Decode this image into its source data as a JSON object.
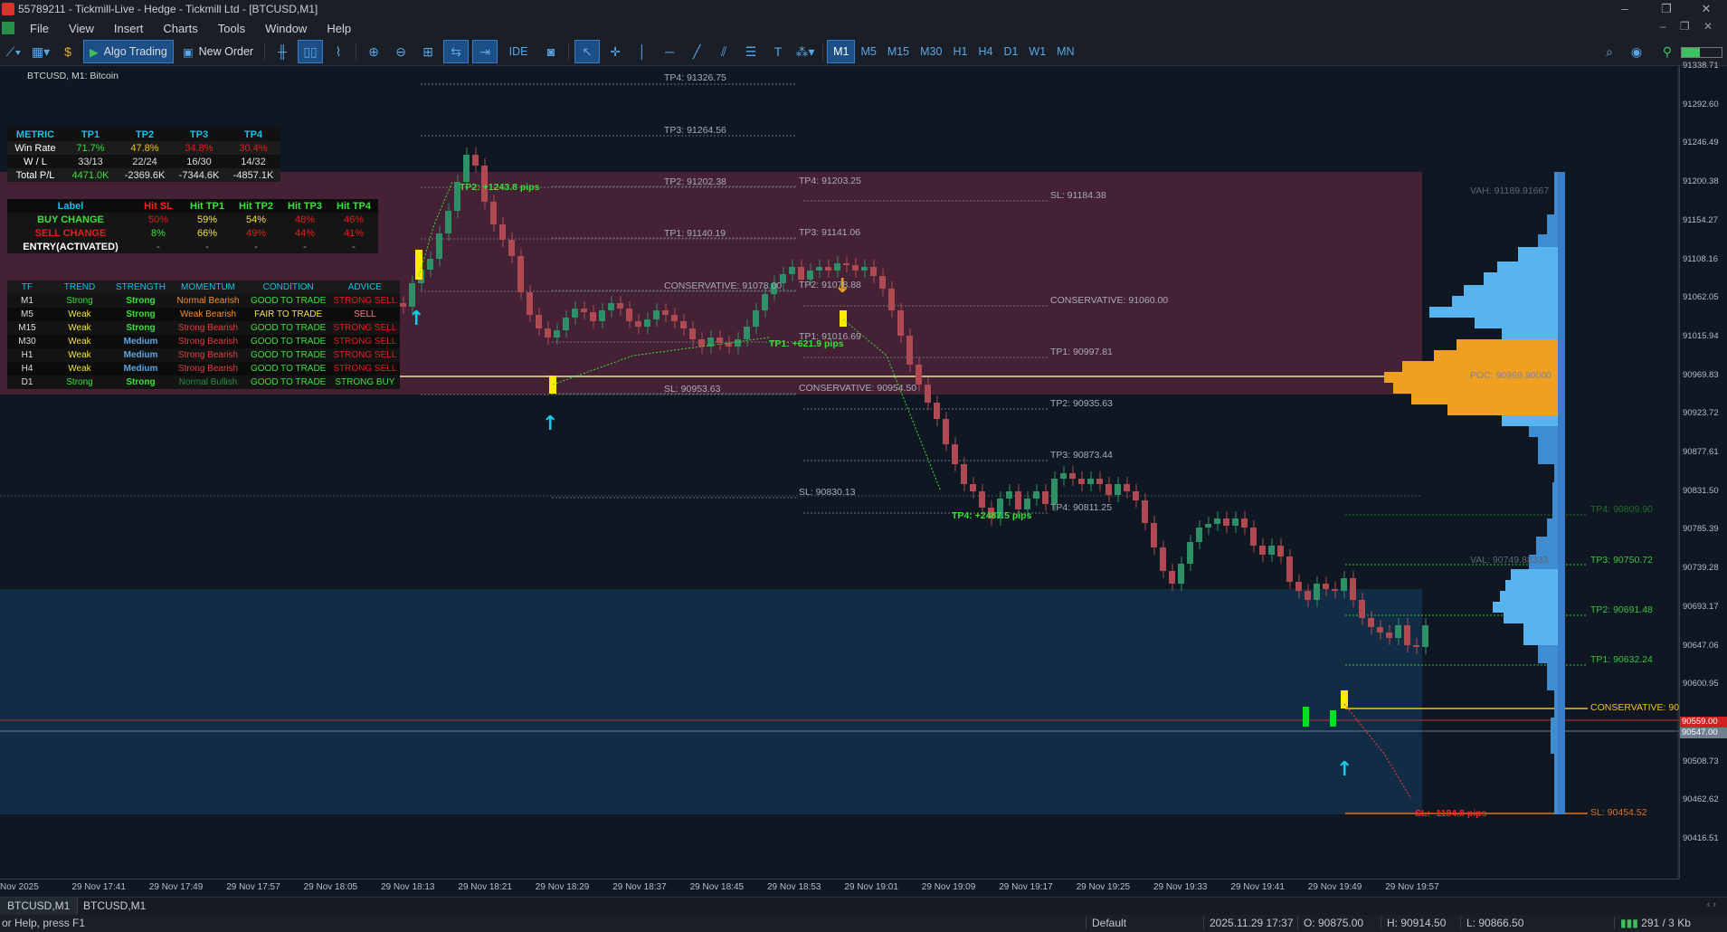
{
  "window": {
    "title": "55789211 - Tickmill-Live - Hedge - Tickmill Ltd - [BTCUSD,M1]",
    "controls": [
      "–",
      "❐",
      "✕"
    ]
  },
  "menu": [
    "File",
    "View",
    "Insert",
    "Charts",
    "Tools",
    "Window",
    "Help"
  ],
  "toolbar": {
    "algo_trading": "Algo Trading",
    "new_order": "New Order",
    "ide": "IDE",
    "timeframes": [
      "M1",
      "M5",
      "M15",
      "M30",
      "H1",
      "H4",
      "D1",
      "W1",
      "MN"
    ],
    "active_tf": "M1"
  },
  "chart": {
    "symbol_label": "BTCUSD, M1:  Bitcoin",
    "colors": {
      "bull": "#2f8f66",
      "bear": "#b04a52",
      "sell_zone": "#4a2236",
      "buy_zone": "#142d48",
      "signal_yellow": "#ffeb00",
      "signal_cyan": "#16c8e8"
    },
    "price_axis": [
      "91338.71",
      "91292.60",
      "91246.49",
      "91200.38",
      "91154.27",
      "91108.16",
      "91062.05",
      "91015.94",
      "90969.83",
      "90923.72",
      "90877.61",
      "90831.50",
      "90785.39",
      "90739.28",
      "90693.17",
      "90647.06",
      "90600.95",
      "90554.84",
      "90508.73",
      "90462.62",
      "90416.51"
    ],
    "bid_badge": "90559.00",
    "ask_badge": "90547.00",
    "time_axis": [
      "Nov 2025",
      "29 Nov 17:41",
      "29 Nov 17:49",
      "29 Nov 17:57",
      "29 Nov 18:05",
      "29 Nov 18:13",
      "29 Nov 18:21",
      "29 Nov 18:29",
      "29 Nov 18:37",
      "29 Nov 18:45",
      "29 Nov 18:53",
      "29 Nov 19:01",
      "29 Nov 19:09",
      "29 Nov 19:17",
      "29 Nov 19:25",
      "29 Nov 19:33",
      "29 Nov 19:41",
      "29 Nov 19:49",
      "29 Nov 19:57"
    ],
    "levels": {
      "a_tp4": "TP4: 91326.75",
      "a_tp3": "TP3: 91264.56",
      "a_tp2": "TP2: 91202.38",
      "a_tp1": "TP1: 91140.19",
      "a_cons": "CONSERVATIVE: 91078.00",
      "a_sl": "SL: 90953.63",
      "b_tp4": "TP4: 91203.25",
      "b_tp3": "TP3: 91141.06",
      "b_tp2": "TP2: 91078.88",
      "b_tp1": "TP1: 91016.69",
      "b_cons": "CONSERVATIVE: 90954.50",
      "b_sl": "SL: 90830.13",
      "c_sl": "SL: 91184.38",
      "c_cons": "CONSERVATIVE: 91060.00",
      "c_tp1": "TP1: 90997.81",
      "c_tp2": "TP2: 90935.63",
      "c_tp3": "TP3: 90873.44",
      "c_tp4": "TP4: 90811.25",
      "d_tp4": "TP4: 90809.90",
      "d_tp3": "TP3: 90750.72",
      "d_tp2": "TP2: 90691.48",
      "d_tp1": "TP1: 90632.24",
      "d_cons": "CONSERVATIVE: 90",
      "d_sl": "SL: 90454.52",
      "vah": "VAH: 91189.91667",
      "poc": "POC: 90969.90000",
      "val": "VAL: 90749.88333"
    },
    "hits": {
      "tp2": "TP2: +1243.8 pips",
      "tp1": "TP1: +621.9 pips",
      "tp4": "TP4: +2487.5 pips",
      "sl": "SL: -1184.8 pips"
    }
  },
  "stats_table": {
    "headers": [
      "METRIC",
      "TP1",
      "TP2",
      "TP3",
      "TP4"
    ],
    "rows": [
      {
        "label": "Win Rate",
        "v": [
          "71.7%",
          "47.8%",
          "34.8%",
          "30.4%"
        ]
      },
      {
        "label": "W / L",
        "v": [
          "33/13",
          "22/24",
          "16/30",
          "14/32"
        ]
      },
      {
        "label": "Total P/L",
        "v": [
          "4471.0K",
          "-2369.6K",
          "-7344.6K",
          "-4857.1K"
        ]
      }
    ]
  },
  "hit_table": {
    "headers": [
      "Label",
      "Hit SL",
      "Hit TP1",
      "Hit TP2",
      "Hit TP3",
      "Hit TP4"
    ],
    "rows": [
      {
        "label": "BUY CHANGE",
        "v": [
          "50%",
          "59%",
          "54%",
          "48%",
          "46%"
        ]
      },
      {
        "label": "SELL CHANGE",
        "v": [
          "8%",
          "66%",
          "49%",
          "44%",
          "41%"
        ]
      },
      {
        "label": "ENTRY(ACTIVATED)",
        "v": [
          "-",
          "-",
          "-",
          "-",
          "-"
        ]
      }
    ]
  },
  "tf_table": {
    "headers": [
      "TF",
      "TREND",
      "STRENGTH",
      "MOMENTUM",
      "CONDITION",
      "ADVICE"
    ],
    "rows": [
      [
        "M1",
        "Strong",
        "Strong",
        "Normal Bearish",
        "GOOD TO TRADE",
        "STRONG SELL"
      ],
      [
        "M5",
        "Weak",
        "Strong",
        "Weak Bearish",
        "FAIR TO TRADE",
        "SELL"
      ],
      [
        "M15",
        "Weak",
        "Strong",
        "Strong Bearish",
        "GOOD TO TRADE",
        "STRONG SELL"
      ],
      [
        "M30",
        "Weak",
        "Medium",
        "Strong Bearish",
        "GOOD TO TRADE",
        "STRONG SELL"
      ],
      [
        "H1",
        "Weak",
        "Medium",
        "Strong Bearish",
        "GOOD TO TRADE",
        "STRONG SELL"
      ],
      [
        "H4",
        "Weak",
        "Medium",
        "Strong Bearish",
        "GOOD TO TRADE",
        "STRONG SELL"
      ],
      [
        "D1",
        "Strong",
        "Strong",
        "Normal Bullish",
        "GOOD TO TRADE",
        "STRONG BUY"
      ]
    ]
  },
  "tabs": [
    "BTCUSD,M1",
    "BTCUSD,M1"
  ],
  "status": {
    "help": "or Help, press F1",
    "profile": "Default",
    "time": "2025.11.29 17:37",
    "open": "O: 90875.00",
    "high": "H: 90914.50",
    "low": "L: 90866.50",
    "net": "291 / 3 Kb"
  }
}
